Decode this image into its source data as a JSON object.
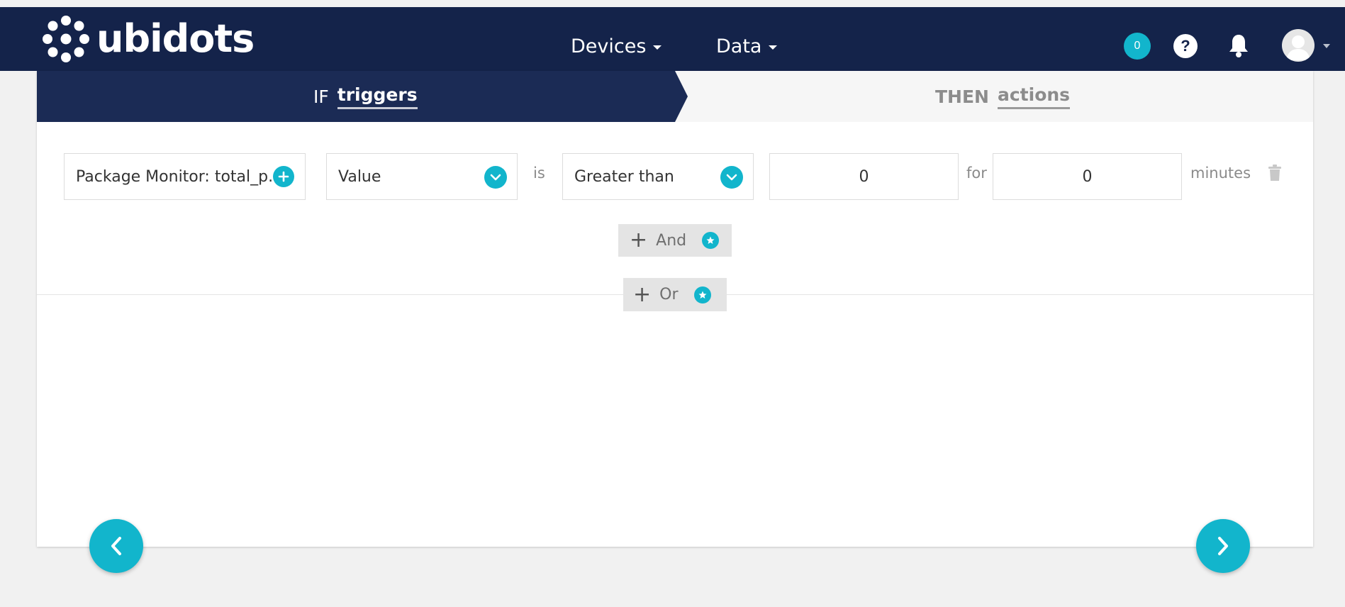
{
  "brand": {
    "name": "ubidots"
  },
  "navbar": {
    "menu": [
      {
        "label": "Devices"
      },
      {
        "label": "Data"
      }
    ],
    "notification_count": "0",
    "help_label": "?"
  },
  "steps": {
    "if": {
      "keyword": "IF",
      "label": "triggers",
      "active": true
    },
    "then": {
      "keyword": "THEN",
      "label": "actions",
      "active": false
    }
  },
  "condition": {
    "variable": "Package Monitor: total_p...",
    "aggregation": "Value",
    "connector_is": "is",
    "operator": "Greater than",
    "threshold": "0",
    "connector_for": "for",
    "duration": "0",
    "duration_unit": "minutes"
  },
  "logic": {
    "and_label": "And",
    "or_label": "Or"
  },
  "colors": {
    "navbar": "#14234a",
    "accent": "#12b5cc",
    "step_active": "#1b2b55"
  }
}
